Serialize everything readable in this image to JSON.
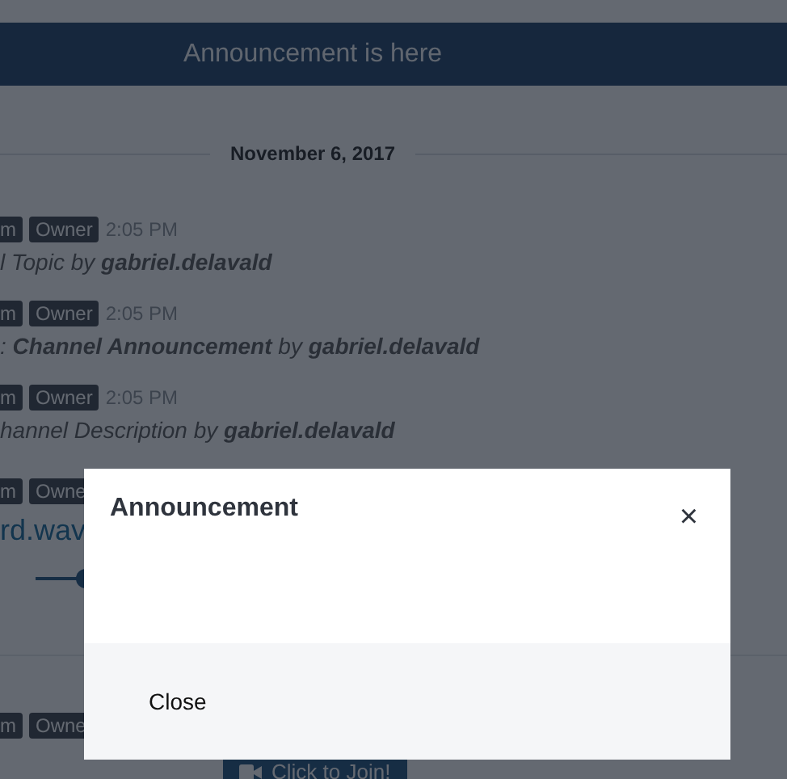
{
  "banner": {
    "text": "Announcement is here"
  },
  "date_divider": "November 6, 2017",
  "messages": [
    {
      "kind": "text",
      "tags": [
        "m",
        "Owner"
      ],
      "time": "2:05 PM",
      "text": "l Topic by **gabriel.delavald**"
    },
    {
      "kind": "text",
      "tags": [
        "m",
        "Owner"
      ],
      "time": "2:05 PM",
      "text": ": **Channel Announcement** by **gabriel.delavald**"
    },
    {
      "kind": "text",
      "tags": [
        "m",
        "Owner"
      ],
      "time": "2:05 PM",
      "text": "hannel Description by **gabriel.delavald**"
    },
    {
      "kind": "file",
      "tags": [
        "m",
        "Owne"
      ],
      "file": "rd.wav",
      "audio": {
        "level": 0.1
      }
    },
    {
      "kind": "call",
      "tags": [
        "m",
        "Owne"
      ],
      "button": "Click to Join!"
    }
  ],
  "modal": {
    "title": "Announcement",
    "close": "×",
    "button": "Close"
  }
}
